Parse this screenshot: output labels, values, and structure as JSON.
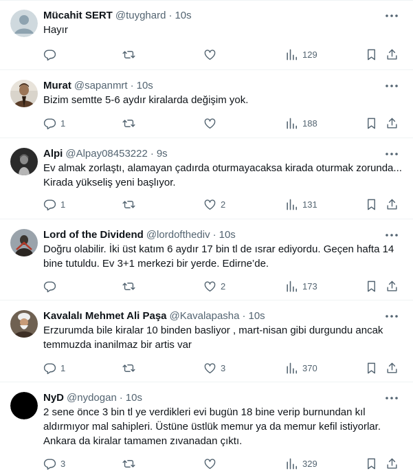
{
  "tweets": [
    {
      "name": "Mücahit SERT",
      "handle": "@tuyghard",
      "sep": "·",
      "time": "10s",
      "text": "Hayır",
      "replies": "",
      "retweets": "",
      "likes": "",
      "views": "129",
      "avatar": "default-avatar"
    },
    {
      "name": "Murat",
      "handle": "@sapanmrt",
      "sep": "·",
      "time": "10s",
      "text": "Bizim semtte 5-6 aydır kiralarda değişim yok.",
      "replies": "1",
      "retweets": "",
      "likes": "",
      "views": "188",
      "avatar": "profile-photo"
    },
    {
      "name": "Alpi",
      "handle": "@Alpay08453222",
      "sep": "·",
      "time": "9s",
      "text": "Ev almak zorlaştı, alamayan çadırda oturmayacaksa kirada oturmak zorunda... Kirada yükseliş yeni başlıyor.",
      "replies": "1",
      "retweets": "",
      "likes": "2",
      "views": "131",
      "avatar": "profile-photo"
    },
    {
      "name": "Lord of the Dividend",
      "handle": "@lordofthediv",
      "sep": "·",
      "time": "10s",
      "text": "Doğru olabilir. İki üst katım 6 aydır 17 bin tl de ısrar ediyordu. Geçen hafta 14 bine tutuldu. Ev 3+1 merkezi bir yerde. Edirne’de.",
      "replies": "",
      "retweets": "",
      "likes": "2",
      "views": "173",
      "avatar": "profile-photo"
    },
    {
      "name": "Kavalalı Mehmet Ali Paşa",
      "handle": "@Kavalapasha",
      "sep": "·",
      "time": "10s",
      "text": "Erzurumda bile kiralar 10 binden basliyor , mart-nisan gibi durgundu ancak temmuzda inanilmaz bir artis var",
      "replies": "1",
      "retweets": "",
      "likes": "3",
      "views": "370",
      "avatar": "profile-photo"
    },
    {
      "name": "NyD",
      "handle": "@nydogan",
      "sep": "·",
      "time": "10s",
      "text": "2 sene önce 3 bin tl ye verdikleri evi bugün 18 bine verip burnundan kıl aldırmıyor mal sahipleri. Üstüne üstlük memur ya da memur kefil istiyorlar. Ankara da kiralar tamamen zıvanadan çıktı.",
      "replies": "3",
      "retweets": "",
      "likes": "",
      "views": "329",
      "avatar": "black-avatar"
    }
  ],
  "icons": {
    "more": "more-dots-icon",
    "reply": "reply-icon",
    "retweet": "retweet-icon",
    "like": "heart-icon",
    "views": "views-icon",
    "bookmark": "bookmark-icon",
    "share": "share-icon"
  },
  "colors": {
    "text": "#0f1419",
    "muted": "#536471",
    "divider": "#eff3f4"
  }
}
